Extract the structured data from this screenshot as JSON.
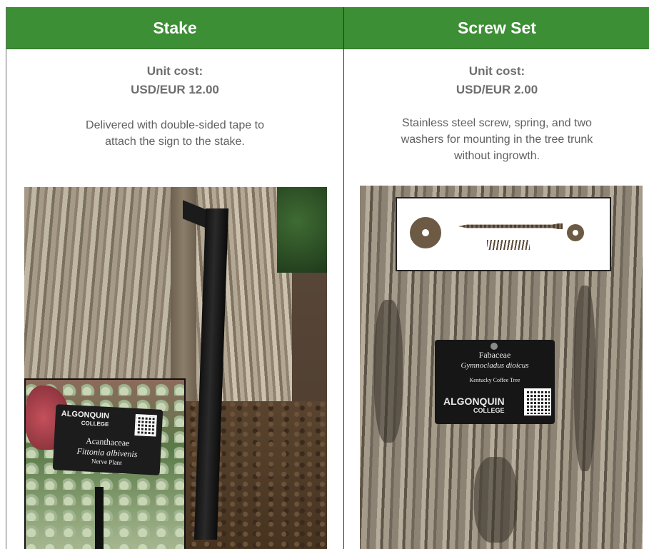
{
  "columns": [
    {
      "title": "Stake",
      "cost_label": "Unit cost:",
      "cost_value": "USD/EUR 12.00",
      "description": "Delivered with double-sided tape to attach the sign to the stake.",
      "inset_sign": {
        "logo": "ALGONQUIN",
        "logo_sub": "COLLEGE",
        "family": "Acanthaceae",
        "scientific": "Fittonia albivenis",
        "common": "Nerve Plant"
      }
    },
    {
      "title": "Screw Set",
      "cost_label": "Unit cost:",
      "cost_value": "USD/EUR 2.00",
      "description": "Stainless steel screw, spring, and two washers for mounting in the tree trunk without ingrowth.",
      "tree_sign": {
        "family": "Fabaceae",
        "scientific": "Gymnocladus dioicus",
        "common": "Kentucky Coffee Tree",
        "logo": "ALGONQUIN",
        "logo_sub": "COLLEGE"
      }
    }
  ],
  "colors": {
    "header_green": "#3c8f34",
    "text_gray": "#6e6e6e"
  }
}
